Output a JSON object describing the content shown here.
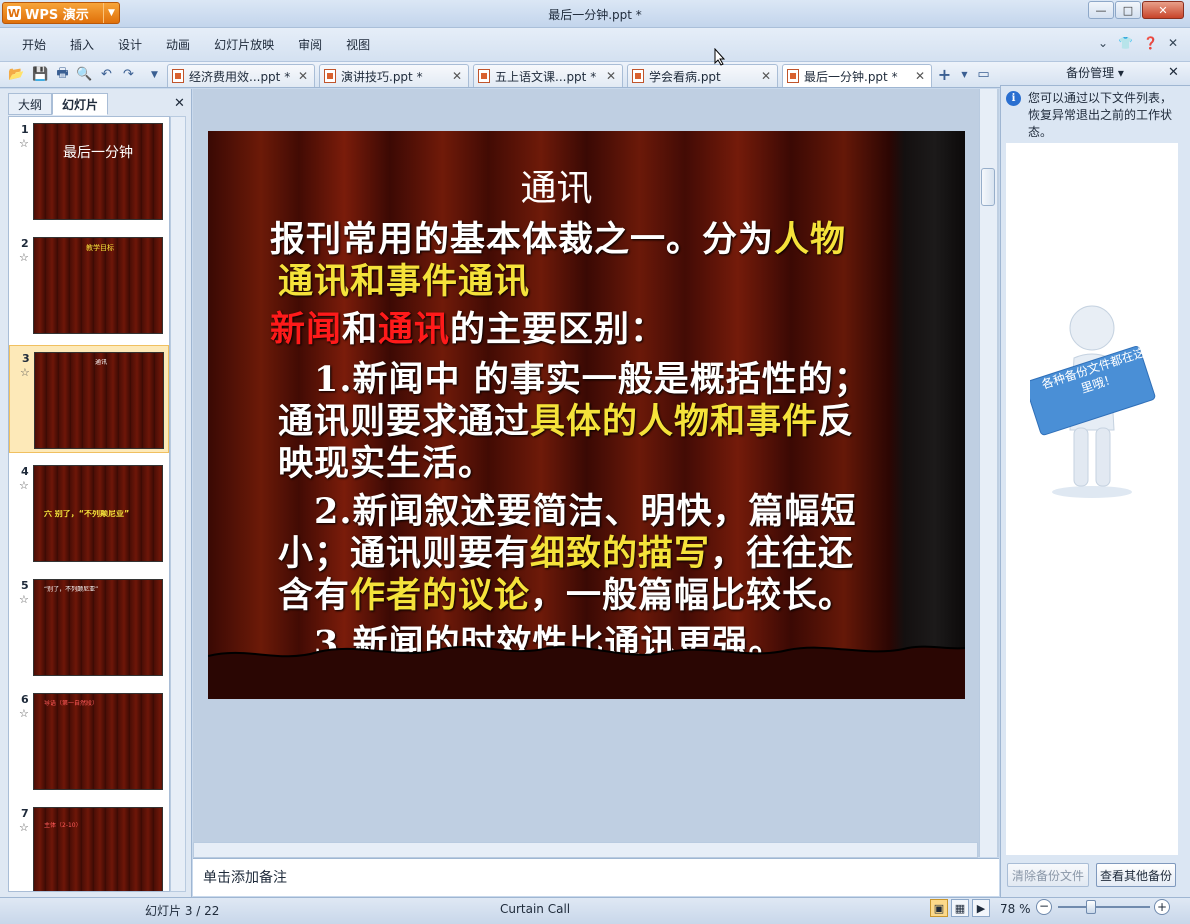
{
  "app": {
    "name": "WPS 演示",
    "window_title": "最后一分钟.ppt *"
  },
  "menu": [
    "开始",
    "插入",
    "设计",
    "动画",
    "幻灯片放映",
    "审阅",
    "视图"
  ],
  "tabs": [
    {
      "label": "经济费用效...ppt *"
    },
    {
      "label": "演讲技巧.ppt *"
    },
    {
      "label": "五上语文课...ppt *"
    },
    {
      "label": "学会看病.ppt"
    },
    {
      "label": "最后一分钟.ppt *"
    }
  ],
  "left_panel": {
    "tabs": [
      "大纲",
      "幻灯片"
    ],
    "thumbnails": [
      {
        "num": "1",
        "text": "最后一分钟"
      },
      {
        "num": "2",
        "text": "教学目标"
      },
      {
        "num": "3",
        "text": "通讯"
      },
      {
        "num": "4",
        "text": "六    别了，“不列颠尼亚”"
      },
      {
        "num": "5",
        "text": "“别了，不列颠尼亚”"
      },
      {
        "num": "6",
        "text": "导语（第一自然段）"
      },
      {
        "num": "7",
        "text": "主体（2-10）"
      }
    ]
  },
  "slide": {
    "title": "通讯",
    "l1a": "报刊常用的基本体裁之一。分为",
    "l1b": "人物",
    "l2": "通讯和事件通讯",
    "l3a": "新闻",
    "l3b": "和",
    "l3c": "通讯",
    "l3d": "的主要区别：",
    "l4": "1.新闻中 的事实一般是概括性的；",
    "l5a": "通讯则要求通过",
    "l5b": "具体的人物和事件",
    "l5c": "反",
    "l6": "映现实生活。",
    "l7": "2.新闻叙述要简洁、明快，篇幅短",
    "l8a": "小；通讯则要有",
    "l8b": "细致的描写",
    "l8c": "，往往还",
    "l9a": "含有",
    "l9b": "作者的议论",
    "l9c": "，一般篇幅比较长。",
    "l10": "3.新闻的时效性比通讯更强。"
  },
  "notes_placeholder": "单击添加备注",
  "backup_pane": {
    "title": "备份管理",
    "info": "您可以通过以下文件列表，恢复异常退出之前的工作状态。",
    "sign_text": "各种备份文件都在这里哦！",
    "clear_button": "清除备份文件",
    "view_button": "查看其他备份"
  },
  "status": {
    "slide": "幻灯片 3 / 22",
    "theme": "Curtain Call",
    "zoom": "78 %"
  },
  "colors": {
    "accent_orange": "#e0700a",
    "slide_yellow": "#f5e23a",
    "slide_red": "#ff1a1a"
  }
}
